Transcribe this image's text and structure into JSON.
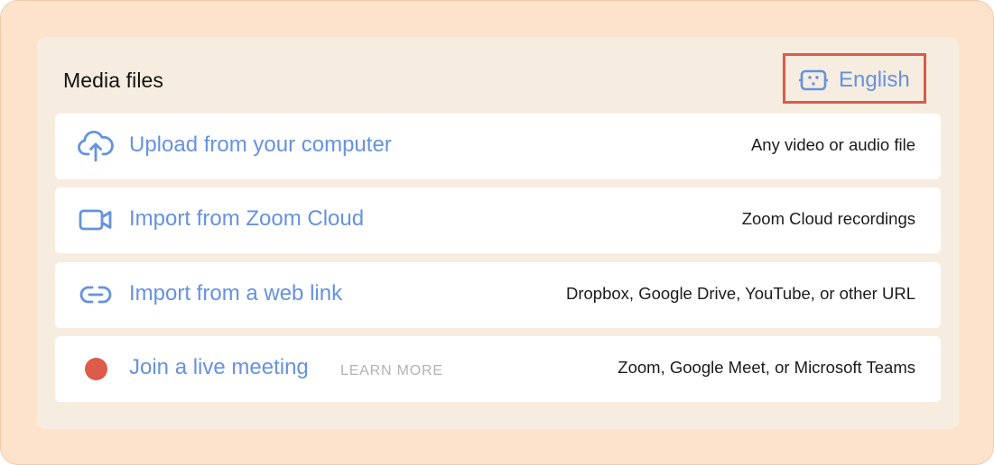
{
  "media": {
    "title": "Media files",
    "language": {
      "label": "English",
      "icon": "language-icon",
      "highlight_color": "#dc5b49"
    },
    "accent_color": "#6592e0",
    "options": [
      {
        "label": "Upload from your computer",
        "description": "Any video or audio file",
        "icon": "cloud-upload-icon"
      },
      {
        "label": "Import from Zoom Cloud",
        "description": "Zoom Cloud recordings",
        "icon": "video-camera-icon"
      },
      {
        "label": "Import from a web link",
        "description": "Dropbox, Google Drive, YouTube, or other URL",
        "icon": "link-icon"
      },
      {
        "label": "Join a live meeting",
        "learn_more": "LEARN MORE",
        "description": "Zoom, Google Meet, or Microsoft Teams",
        "icon": "live-dot-icon",
        "icon_color": "#dc5b49"
      }
    ]
  }
}
